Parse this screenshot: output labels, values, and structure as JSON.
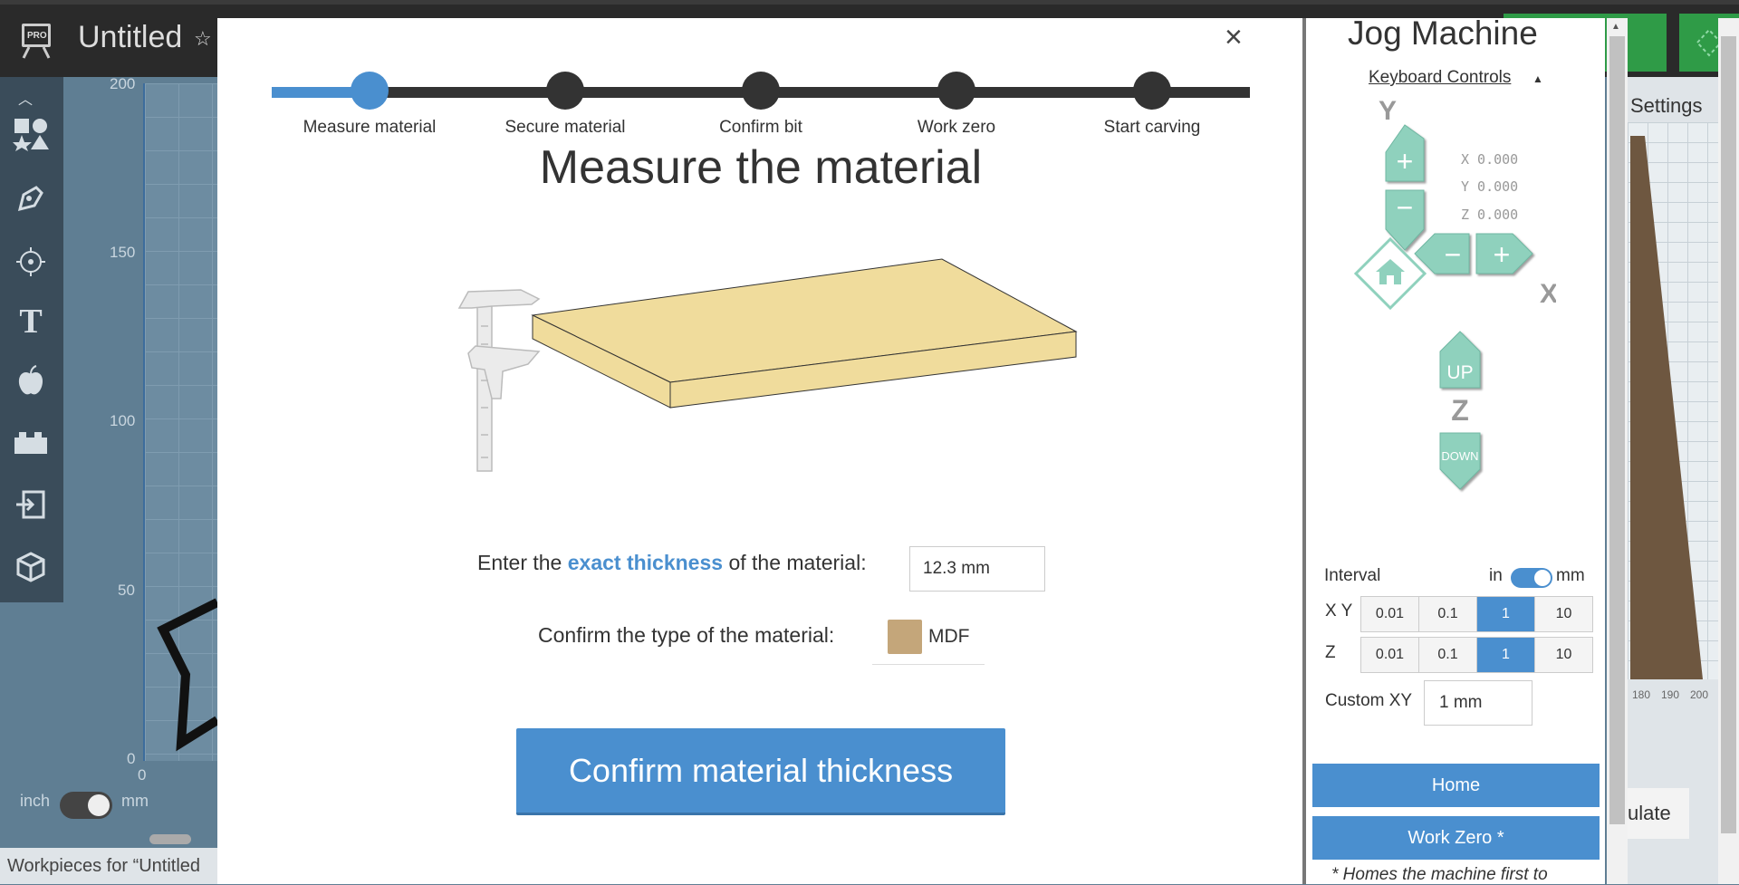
{
  "app": {
    "badge": "PRO",
    "doc_title": "Untitled",
    "fav_icon": "star-outline-icon",
    "settings_label": "Settings",
    "simulate_partial": "ulate",
    "workpieces_label": "Workpieces for “Untitled"
  },
  "canvas": {
    "y_ticks": [
      "200",
      "150",
      "100",
      "50",
      "0"
    ],
    "x_origin": "0",
    "unit_left": "inch",
    "unit_right": "mm",
    "ruler_ticks": [
      "180",
      "190",
      "200"
    ]
  },
  "wizard": {
    "close_label": "×",
    "progress_fraction": 0.1,
    "steps": [
      {
        "label": "Measure material",
        "active": true
      },
      {
        "label": "Secure material",
        "active": false
      },
      {
        "label": "Confirm bit",
        "active": false
      },
      {
        "label": "Work zero",
        "active": false
      },
      {
        "label": "Start carving",
        "active": false
      }
    ],
    "heading": "Measure the material",
    "thickness_prefix": "Enter the ",
    "thickness_emphasis": "exact thickness",
    "thickness_suffix": " of the material:",
    "thickness_value": "12.3 mm",
    "type_prompt": "Confirm the type of the material:",
    "material_name": "MDF",
    "confirm_label": "Confirm material thickness",
    "accent": "#4a8fcf"
  },
  "jog": {
    "title": "Jog Machine",
    "keyboard_controls": "Keyboard Controls",
    "axis_y": "Y",
    "axis_x": "X",
    "axis_z": "Z",
    "plus": "+",
    "minus": "−",
    "up_label": "UP",
    "down_label": "DOWN",
    "coords": [
      "X 0.000",
      "Y 0.000",
      "Z 0.000"
    ],
    "interval_label": "Interval",
    "unit_in": "in",
    "unit_mm": "mm",
    "xy_label": "X Y",
    "z_label": "Z",
    "xy_steps": [
      "0.01",
      "0.1",
      "1",
      "10"
    ],
    "z_steps": [
      "0.01",
      "0.1",
      "1",
      "10"
    ],
    "selected_step": "1",
    "custom_label": "Custom XY",
    "custom_value": "1 mm",
    "home_label": "Home",
    "work_zero_label": "Work Zero *",
    "footnote": "* Homes the machine first to",
    "button_color": "#8fd1bd"
  }
}
